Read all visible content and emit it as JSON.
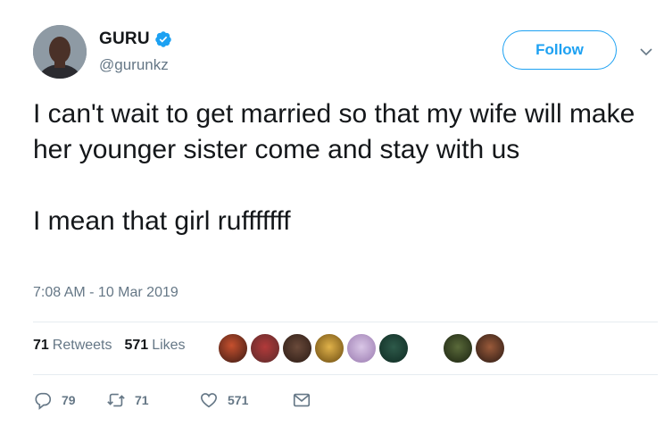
{
  "author": {
    "display_name": "GURU",
    "handle": "@gurunkz",
    "verified": true,
    "avatar_icon": "profile-photo"
  },
  "header": {
    "follow_label": "Follow",
    "more_icon": "chevron-down-icon"
  },
  "tweet": {
    "text": "I can't wait to get married so that my wife will make her younger sister come and stay with us\n\nI mean that girl rufffffff",
    "timestamp": "7:08 AM - 10 Mar 2019"
  },
  "stats": {
    "retweets_count": "71",
    "retweets_label": "Retweets",
    "likes_count": "571",
    "likes_label": "Likes"
  },
  "actions": {
    "reply_count": "79",
    "retweet_count": "71",
    "like_count": "571"
  },
  "colors": {
    "accent": "#1da1f2",
    "secondary_text": "#657786",
    "divider": "#e6ecf0"
  }
}
